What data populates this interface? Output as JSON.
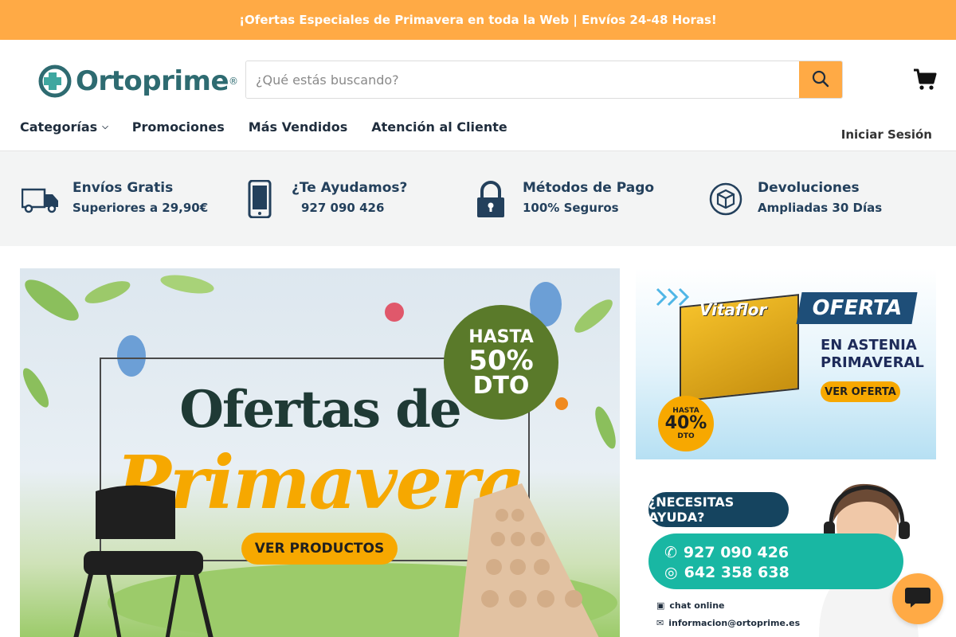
{
  "announcement": {
    "text": "¡Ofertas Especiales de Primavera en toda la Web | Envíos 24-48 Horas!"
  },
  "header": {
    "logo_text": "Ortoprime",
    "logo_mark": "®",
    "search": {
      "placeholder": "¿Qué estás buscando?",
      "value": ""
    },
    "cart_icon": "cart-icon"
  },
  "nav": {
    "items": [
      {
        "label": "Categorías"
      },
      {
        "label": "Promociones"
      },
      {
        "label": "Más Vendidos"
      },
      {
        "label": "Atención al Cliente"
      }
    ],
    "signin": "Iniciar Sesión"
  },
  "features": [
    {
      "icon": "truck-icon",
      "title": "Envíos Gratis",
      "subtitle": "Superiores a 29,90€"
    },
    {
      "icon": "phone-icon",
      "title": "¿Te Ayudamos?",
      "subtitle": "927 090 426"
    },
    {
      "icon": "lock-icon",
      "title": "Métodos de Pago",
      "subtitle": "100% Seguros"
    },
    {
      "icon": "returns-box-icon",
      "title": "Devoluciones",
      "subtitle": "Ampliadas 30 Días"
    }
  ],
  "hero": {
    "title_line1": "Ofertas de",
    "title_line2": "Primavera",
    "badge_l1": "HASTA",
    "badge_l2": "50%",
    "badge_l3": "DTO",
    "cta": "VER PRODUCTOS"
  },
  "promo_offer": {
    "tag": "OFERTA",
    "line1": "EN ASTENIA",
    "line2": "PRIMAVERAL",
    "cta": "VER OFERTA",
    "badge_small": "HASTA",
    "badge_pct": "40%",
    "badge_dto": "DTO",
    "brand": "Vitaflor"
  },
  "promo_help": {
    "title": "¿NECESITAS AYUDA?",
    "phone1": "927 090 426",
    "phone2": "642 358 638",
    "chat": "chat online",
    "email": "informacion@ortoprime.es"
  },
  "colors": {
    "accent": "#ffaa45",
    "navy": "#23405c",
    "teal": "#19b7a3"
  }
}
